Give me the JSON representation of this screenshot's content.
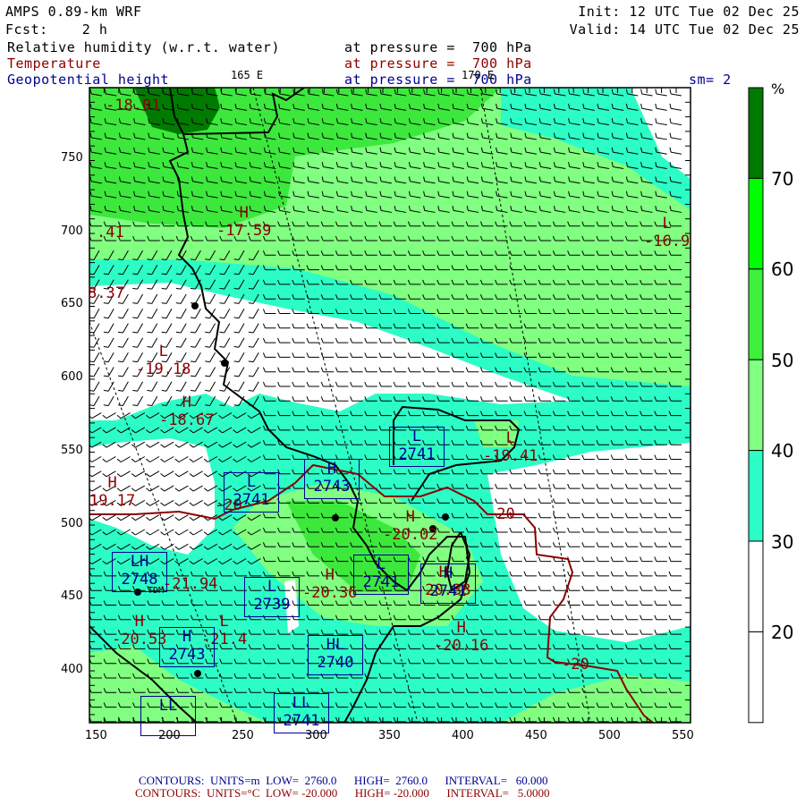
{
  "header": {
    "model": "AMPS 0.89-km WRF",
    "fcst": "Fcst:    2 h",
    "init": "Init: 12 UTC Tue 02 Dec 25",
    "valid": "Valid: 14 UTC Tue 02 Dec 25",
    "fields": [
      {
        "name": "Relative humidity (w.r.t. water)",
        "level": "at pressure =  700 hPa"
      },
      {
        "name": "Temperature",
        "level": "at pressure =  700 hPa"
      },
      {
        "name": "Geopotential height",
        "level": "at pressure =  700 hPa"
      }
    ],
    "smoothing": "sm= 2",
    "lon_labels": [
      "165 E",
      "170 E"
    ]
  },
  "axes": {
    "x_ticks": [
      "150",
      "200",
      "250",
      "300",
      "350",
      "400",
      "450",
      "500",
      "550"
    ],
    "y_ticks": [
      "750",
      "700",
      "650",
      "600",
      "550",
      "500",
      "450",
      "400"
    ]
  },
  "colorbar": {
    "unit": "%",
    "labels": [
      "70",
      "60",
      "50",
      "40",
      "30",
      "20"
    ],
    "colors": [
      "#007a00",
      "#00ff00",
      "#3cf03c",
      "#80ff80",
      "#2cfcc6",
      "#ffffff",
      "#ffffff"
    ]
  },
  "temperature_labels": [
    {
      "hl": "",
      "value": "-18.01"
    },
    {
      "hl": "H",
      "value": "-17.59"
    },
    {
      "hl": "",
      "value": ".41"
    },
    {
      "hl": "",
      "value": "8.37"
    },
    {
      "hl": "L",
      "value": "-19.18"
    },
    {
      "hl": "H",
      "value": "-18.67"
    },
    {
      "hl": "H",
      "value": "19.17"
    },
    {
      "hl": "",
      "value": "-20"
    },
    {
      "hl": "H",
      "value": "-20.02"
    },
    {
      "hl": "L",
      "value": "-19.41"
    },
    {
      "hl": "",
      "value": "-20"
    },
    {
      "hl": "H",
      "value": "-20.36"
    },
    {
      "hl": "H",
      "value": "-20.53"
    },
    {
      "hl": "L",
      "value": "-21.4"
    },
    {
      "hl": "H",
      "value": "-20.16"
    },
    {
      "hl": "",
      "value": "-20"
    },
    {
      "hl": "L",
      "value": "-16.9"
    },
    {
      "hl": "",
      "value": "-21.94"
    },
    {
      "hl": "H",
      "value": "-20.38"
    }
  ],
  "height_labels": [
    {
      "hl": "L",
      "value": "2741"
    },
    {
      "hl": "H",
      "value": "2743"
    },
    {
      "hl": "L",
      "value": "2741"
    },
    {
      "hl": "L",
      "value": "2741"
    },
    {
      "hl": "H",
      "value": "2741"
    },
    {
      "hl": "LH",
      "value": "2748"
    },
    {
      "hl": "L",
      "value": "2739"
    },
    {
      "hl": "H",
      "value": "2743"
    },
    {
      "hl": "HL",
      "value": "2740"
    },
    {
      "hl": "LL",
      "value": ""
    },
    {
      "hl": "LL",
      "value": "2741"
    }
  ],
  "station_label": "TDM",
  "footer": {
    "height": {
      "contours": "CONTOURS:",
      "units": "UNITS=m",
      "low": "LOW=  2760.0",
      "high": "HIGH=  2760.0",
      "interval": "INTERVAL=   60.000"
    },
    "temp": {
      "contours": "CONTOURS:",
      "units": "UNITS=°C",
      "low": "LOW= -20.000",
      "high": "HIGH= -20.000",
      "interval": "INTERVAL=   5.0000"
    }
  }
}
